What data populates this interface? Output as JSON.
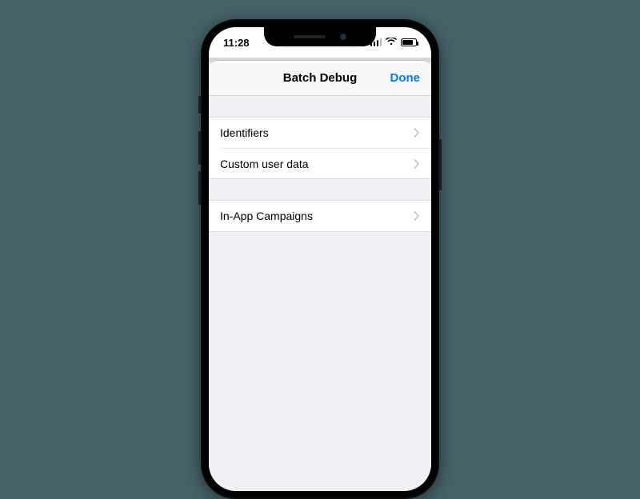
{
  "status": {
    "time": "11:28"
  },
  "nav": {
    "title": "Batch Debug",
    "done": "Done"
  },
  "groups": [
    {
      "rows": [
        "Identifiers",
        "Custom user data"
      ]
    },
    {
      "rows": [
        "In-App Campaigns"
      ]
    }
  ]
}
